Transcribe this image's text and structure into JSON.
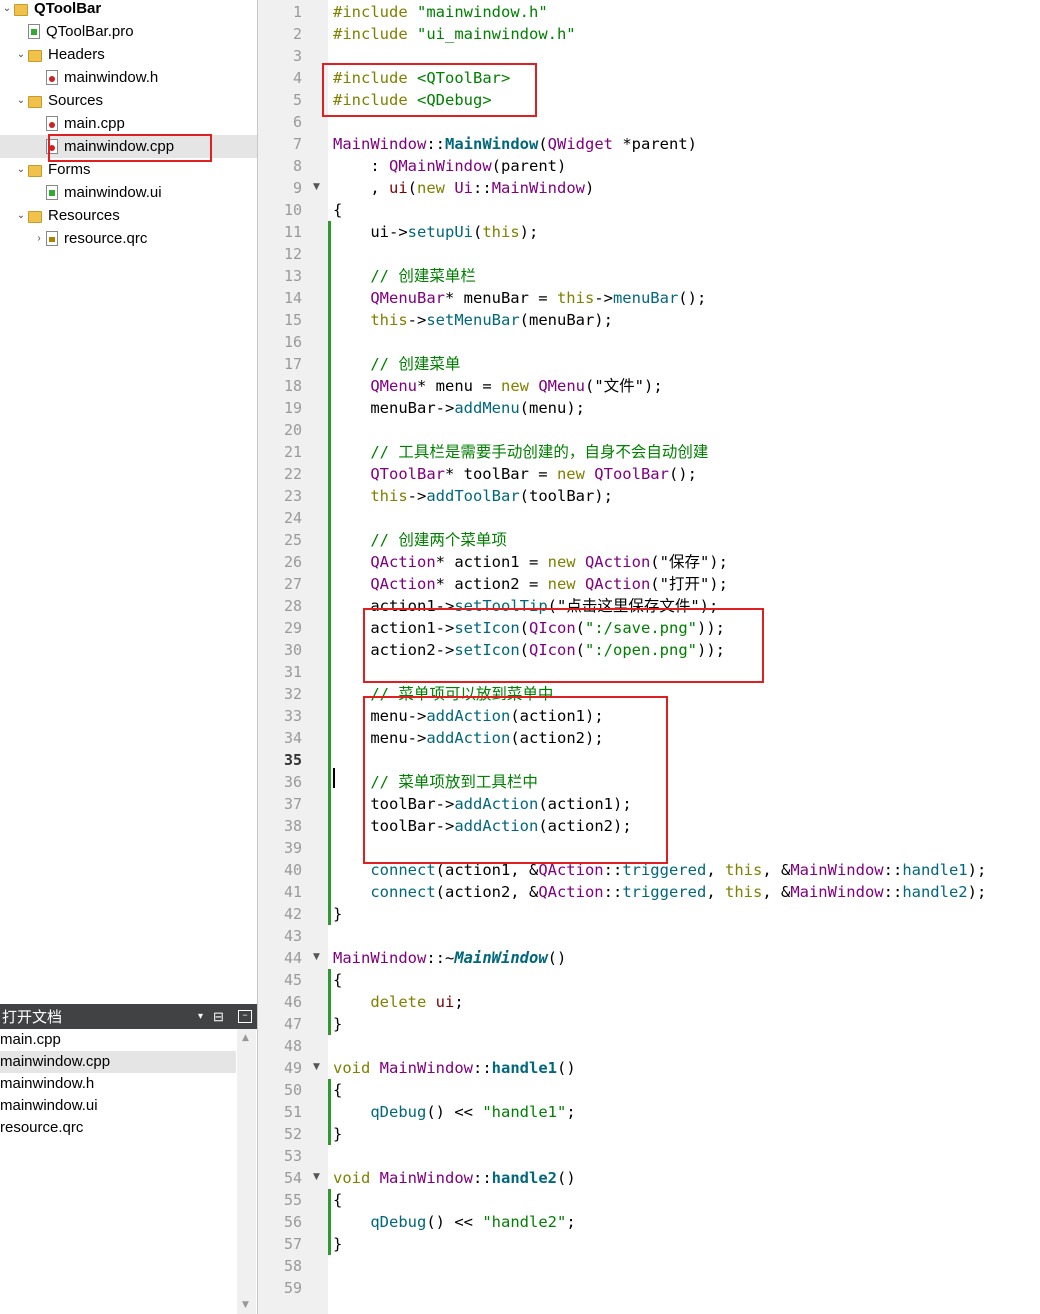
{
  "project_tree": {
    "items": [
      {
        "label": "QToolBar",
        "indent": 0,
        "arrow": "⌄",
        "icon": "project-icon",
        "bold": true
      },
      {
        "label": "QToolBar.pro",
        "indent": 1,
        "arrow": "",
        "icon": "pro-file-icon"
      },
      {
        "label": "Headers",
        "indent": 1,
        "arrow": "⌄",
        "icon": "folder-icon"
      },
      {
        "label": "mainwindow.h",
        "indent": 2,
        "arrow": "",
        "icon": "header-file-icon"
      },
      {
        "label": "Sources",
        "indent": 1,
        "arrow": "⌄",
        "icon": "folder-icon"
      },
      {
        "label": "main.cpp",
        "indent": 2,
        "arrow": "",
        "icon": "cpp-file-icon"
      },
      {
        "label": "mainwindow.cpp",
        "indent": 2,
        "arrow": "",
        "icon": "cpp-file-icon",
        "selected": true
      },
      {
        "label": "Forms",
        "indent": 1,
        "arrow": "⌄",
        "icon": "folder-icon"
      },
      {
        "label": "mainwindow.ui",
        "indent": 2,
        "arrow": "",
        "icon": "ui-file-icon"
      },
      {
        "label": "Resources",
        "indent": 1,
        "arrow": "⌄",
        "icon": "folder-icon"
      },
      {
        "label": "resource.qrc",
        "indent": 2,
        "arrow": "›",
        "icon": "qrc-file-icon"
      }
    ]
  },
  "open_docs": {
    "title": "打开文档",
    "items": [
      "main.cpp",
      "mainwindow.cpp",
      "mainwindow.h",
      "mainwindow.ui",
      "resource.qrc"
    ],
    "selected_index": 1
  },
  "editor": {
    "current_line": 35,
    "line_count": 59,
    "fold_lines": [
      9,
      44,
      49,
      54
    ],
    "lines": [
      [
        [
          "#include ",
          "k"
        ],
        [
          "\"mainwindow.h\"",
          "s"
        ]
      ],
      [
        [
          "#include ",
          "k"
        ],
        [
          "\"ui_mainwindow.h\"",
          "s"
        ]
      ],
      [],
      [
        [
          "#include ",
          "k"
        ],
        [
          "<QToolBar>",
          "s"
        ]
      ],
      [
        [
          "#include ",
          "k"
        ],
        [
          "<QDebug>",
          "s"
        ]
      ],
      [],
      [
        [
          "MainWindow",
          "t"
        ],
        [
          "::",
          "p"
        ],
        [
          "MainWindow",
          "fb"
        ],
        [
          "(",
          "p"
        ],
        [
          "QWidget",
          "t"
        ],
        [
          " *parent)",
          "p"
        ]
      ],
      [
        [
          "    : ",
          "p"
        ],
        [
          "QMainWindow",
          "t"
        ],
        [
          "(parent)",
          "p"
        ]
      ],
      [
        [
          "    , ",
          "p"
        ],
        [
          "ui",
          "m"
        ],
        [
          "(",
          "p"
        ],
        [
          "new ",
          "kw"
        ],
        [
          "Ui",
          "t"
        ],
        [
          "::",
          "p"
        ],
        [
          "MainWindow",
          "t"
        ],
        [
          ")",
          "p"
        ]
      ],
      [
        [
          "{",
          "p"
        ]
      ],
      [
        [
          "    ui->",
          "p"
        ],
        [
          "setupUi",
          "f"
        ],
        [
          "(",
          "p"
        ],
        [
          "this",
          "kw"
        ],
        [
          ");",
          "p"
        ]
      ],
      [],
      [
        [
          "    // 创建菜单栏",
          "c"
        ]
      ],
      [
        [
          "    ",
          "p"
        ],
        [
          "QMenuBar",
          "t"
        ],
        [
          "* menuBar = ",
          "p"
        ],
        [
          "this",
          "kw"
        ],
        [
          "->",
          "p"
        ],
        [
          "menuBar",
          "f"
        ],
        [
          "();",
          "p"
        ]
      ],
      [
        [
          "    ",
          "p"
        ],
        [
          "this",
          "kw"
        ],
        [
          "->",
          "p"
        ],
        [
          "setMenuBar",
          "f"
        ],
        [
          "(menuBar);",
          "p"
        ]
      ],
      [],
      [
        [
          "    // 创建菜单",
          "c"
        ]
      ],
      [
        [
          "    ",
          "p"
        ],
        [
          "QMenu",
          "t"
        ],
        [
          "* menu = ",
          "p"
        ],
        [
          "new ",
          "kw"
        ],
        [
          "QMenu",
          "t"
        ],
        [
          "(\"文件\");",
          "p"
        ]
      ],
      [
        [
          "    menuBar->",
          "p"
        ],
        [
          "addMenu",
          "f"
        ],
        [
          "(menu);",
          "p"
        ]
      ],
      [],
      [
        [
          "    // 工具栏是需要手动创建的，自身不会自动创建",
          "c"
        ]
      ],
      [
        [
          "    ",
          "p"
        ],
        [
          "QToolBar",
          "t"
        ],
        [
          "* toolBar = ",
          "p"
        ],
        [
          "new ",
          "kw"
        ],
        [
          "QToolBar",
          "t"
        ],
        [
          "();",
          "p"
        ]
      ],
      [
        [
          "    ",
          "p"
        ],
        [
          "this",
          "kw"
        ],
        [
          "->",
          "p"
        ],
        [
          "addToolBar",
          "f"
        ],
        [
          "(toolBar);",
          "p"
        ]
      ],
      [],
      [
        [
          "    // 创建两个菜单项",
          "c"
        ]
      ],
      [
        [
          "    ",
          "p"
        ],
        [
          "QAction",
          "t"
        ],
        [
          "* action1 = ",
          "p"
        ],
        [
          "new ",
          "kw"
        ],
        [
          "QAction",
          "t"
        ],
        [
          "(\"保存\");",
          "p"
        ]
      ],
      [
        [
          "    ",
          "p"
        ],
        [
          "QAction",
          "t"
        ],
        [
          "* action2 = ",
          "p"
        ],
        [
          "new ",
          "kw"
        ],
        [
          "QAction",
          "t"
        ],
        [
          "(\"打开\");",
          "p"
        ]
      ],
      [
        [
          "    action1->",
          "p"
        ],
        [
          "setToolTip",
          "f"
        ],
        [
          "(\"点击这里保存文件\");",
          "p"
        ]
      ],
      [
        [
          "    action1->",
          "p"
        ],
        [
          "setIcon",
          "f"
        ],
        [
          "(",
          "p"
        ],
        [
          "QIcon",
          "t"
        ],
        [
          "(",
          "p"
        ],
        [
          "\":/save.png\"",
          "s"
        ],
        [
          "));",
          "p"
        ]
      ],
      [
        [
          "    action2->",
          "p"
        ],
        [
          "setIcon",
          "f"
        ],
        [
          "(",
          "p"
        ],
        [
          "QIcon",
          "t"
        ],
        [
          "(",
          "p"
        ],
        [
          "\":/open.png\"",
          "s"
        ],
        [
          "));",
          "p"
        ]
      ],
      [],
      [
        [
          "    // 菜单项可以放到菜单中",
          "c"
        ]
      ],
      [
        [
          "    menu->",
          "p"
        ],
        [
          "addAction",
          "f"
        ],
        [
          "(action1);",
          "p"
        ]
      ],
      [
        [
          "    menu->",
          "p"
        ],
        [
          "addAction",
          "f"
        ],
        [
          "(action2);",
          "p"
        ]
      ],
      [],
      [
        [
          "    // 菜单项放到工具栏中",
          "c"
        ]
      ],
      [
        [
          "    toolBar->",
          "p"
        ],
        [
          "addAction",
          "f"
        ],
        [
          "(action1);",
          "p"
        ]
      ],
      [
        [
          "    toolBar->",
          "p"
        ],
        [
          "addAction",
          "f"
        ],
        [
          "(action2);",
          "p"
        ]
      ],
      [],
      [
        [
          "    ",
          "p"
        ],
        [
          "connect",
          "f"
        ],
        [
          "(action1, &",
          "p"
        ],
        [
          "QAction",
          "t"
        ],
        [
          "::",
          "p"
        ],
        [
          "triggered",
          "f"
        ],
        [
          ", ",
          "p"
        ],
        [
          "this",
          "kw"
        ],
        [
          ", &",
          "p"
        ],
        [
          "MainWindow",
          "t"
        ],
        [
          "::",
          "p"
        ],
        [
          "handle1",
          "f"
        ],
        [
          ");",
          "p"
        ]
      ],
      [
        [
          "    ",
          "p"
        ],
        [
          "connect",
          "f"
        ],
        [
          "(action2, &",
          "p"
        ],
        [
          "QAction",
          "t"
        ],
        [
          "::",
          "p"
        ],
        [
          "triggered",
          "f"
        ],
        [
          ", ",
          "p"
        ],
        [
          "this",
          "kw"
        ],
        [
          ", &",
          "p"
        ],
        [
          "MainWindow",
          "t"
        ],
        [
          "::",
          "p"
        ],
        [
          "handle2",
          "f"
        ],
        [
          ");",
          "p"
        ]
      ],
      [
        [
          "}",
          "p"
        ]
      ],
      [],
      [
        [
          "MainWindow",
          "t"
        ],
        [
          "::~",
          "p"
        ],
        [
          "MainWindow",
          "fi"
        ],
        [
          "()",
          "p"
        ]
      ],
      [
        [
          "{",
          "p"
        ]
      ],
      [
        [
          "    ",
          "p"
        ],
        [
          "delete ",
          "kw"
        ],
        [
          "ui",
          "m"
        ],
        [
          ";",
          "p"
        ]
      ],
      [
        [
          "}",
          "p"
        ]
      ],
      [],
      [
        [
          "void ",
          "kw"
        ],
        [
          "MainWindow",
          "t"
        ],
        [
          "::",
          "p"
        ],
        [
          "handle1",
          "fb"
        ],
        [
          "()",
          "p"
        ]
      ],
      [
        [
          "{",
          "p"
        ]
      ],
      [
        [
          "    ",
          "p"
        ],
        [
          "qDebug",
          "f"
        ],
        [
          "() << ",
          "p"
        ],
        [
          "\"handle1\"",
          "s"
        ],
        [
          ";",
          "p"
        ]
      ],
      [
        [
          "}",
          "p"
        ]
      ],
      [],
      [
        [
          "void ",
          "kw"
        ],
        [
          "MainWindow",
          "t"
        ],
        [
          "::",
          "p"
        ],
        [
          "handle2",
          "fb"
        ],
        [
          "()",
          "p"
        ]
      ],
      [
        [
          "{",
          "p"
        ]
      ],
      [
        [
          "    ",
          "p"
        ],
        [
          "qDebug",
          "f"
        ],
        [
          "() << ",
          "p"
        ],
        [
          "\"handle2\"",
          "s"
        ],
        [
          ";",
          "p"
        ]
      ],
      [
        [
          "}",
          "p"
        ]
      ],
      [],
      []
    ]
  },
  "colors": {
    "keyword": "#808000",
    "string": "#008000",
    "type": "#800080",
    "function": "#00677c",
    "member": "#800000",
    "comment": "#008000",
    "plain": "#000000",
    "highlight_border": "#e02020",
    "gutter_bg": "#f0f0f0",
    "revision_bar": "#2e9a2e"
  }
}
